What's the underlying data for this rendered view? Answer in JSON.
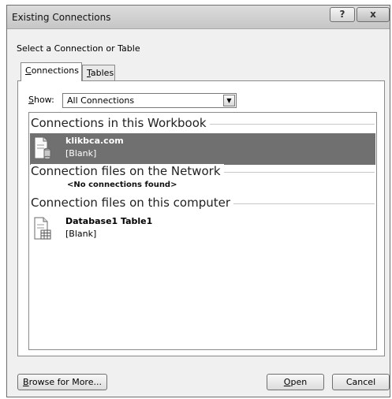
{
  "window": {
    "title": "Existing Connections",
    "help_glyph": "?",
    "close_glyph": "x"
  },
  "prompt": "Select a Connection or Table",
  "tabs": [
    {
      "key": "C",
      "rest": "onnections"
    },
    {
      "key": "T",
      "rest": "ables"
    }
  ],
  "show": {
    "label_key": "S",
    "label_rest": "how:",
    "value": "All Connections"
  },
  "groups": [
    {
      "label": "Connections in this Workbook"
    },
    {
      "label": "Connection files on the Network",
      "empty_text": "<No connections found>"
    },
    {
      "label": "Connection files on this computer"
    }
  ],
  "items": [
    {
      "name": "klikbca.com",
      "desc": "[Blank]",
      "icon": "workbook-connection-icon",
      "selected": true
    },
    {
      "name": "Database1 Table1",
      "desc": "[Blank]",
      "icon": "table-connection-icon",
      "selected": false
    }
  ],
  "buttons": {
    "browse_key": "B",
    "browse_rest": "rowse for More...",
    "open_key": "O",
    "open_rest": "pen",
    "cancel": "Cancel"
  },
  "colors": {
    "selection": "#707070",
    "dialog_bg": "#f0f0f0"
  }
}
